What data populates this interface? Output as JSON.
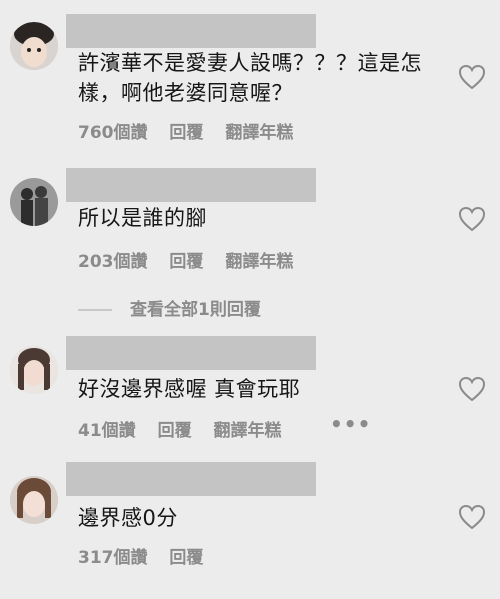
{
  "comments": [
    {
      "text": "許濱華不是愛妻人設嗎？？？這是怎樣，啊他老婆同意喔？",
      "likes": "760個讚",
      "reply": "回覆",
      "translate": "翻譯年糕"
    },
    {
      "text": "所以是誰的腳",
      "likes": "203個讚",
      "reply": "回覆",
      "translate": "翻譯年糕"
    },
    {
      "text": "好沒邊界感喔 真會玩耶",
      "likes": "41個讚",
      "reply": "回覆",
      "translate": "翻譯年糕",
      "more": "•••"
    },
    {
      "text": "邊界感0分",
      "likes": "317個讚",
      "reply": "回覆"
    }
  ],
  "view_replies": "查看全部1則回覆",
  "colors": {
    "background": "#ececec",
    "text": "#161616",
    "meta": "#8b8b8b",
    "redaction": "#c4c4c4"
  }
}
